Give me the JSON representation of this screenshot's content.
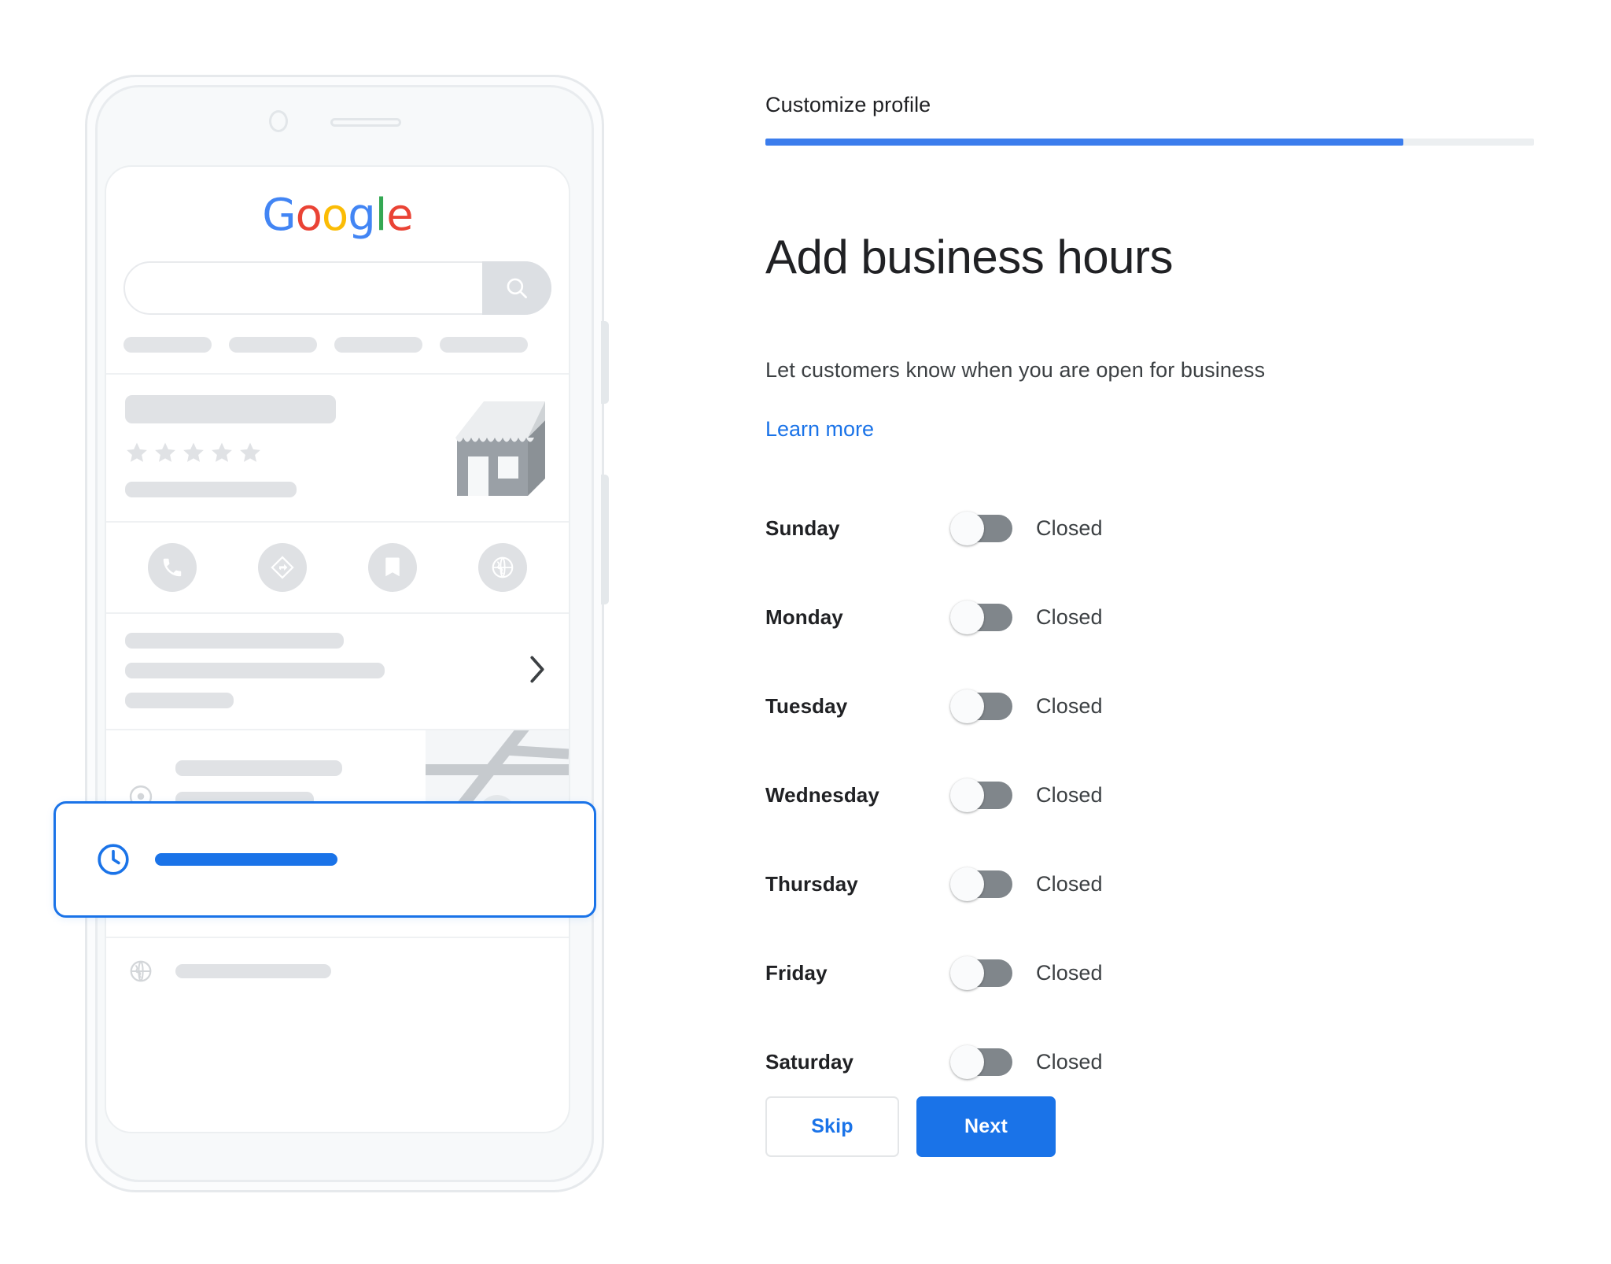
{
  "meta": {
    "accent_blue": "#1a73e8",
    "progress_blue": "#3b7ded",
    "toggle_track_gray": "#80868b",
    "skeleton_gray": "#e0e2e5",
    "text_primary": "#202124",
    "text_secondary": "#3c4043"
  },
  "header": {
    "step_label": "Customize profile",
    "progress_percent": 83
  },
  "main": {
    "title": "Add business hours",
    "subtitle": "Let customers know when you are open for business",
    "learn_more_label": "Learn more"
  },
  "hours": {
    "closed_label": "Closed",
    "days": [
      {
        "name": "Sunday",
        "state": "Closed",
        "enabled": false
      },
      {
        "name": "Monday",
        "state": "Closed",
        "enabled": false
      },
      {
        "name": "Tuesday",
        "state": "Closed",
        "enabled": false
      },
      {
        "name": "Wednesday",
        "state": "Closed",
        "enabled": false
      },
      {
        "name": "Thursday",
        "state": "Closed",
        "enabled": false
      },
      {
        "name": "Friday",
        "state": "Closed",
        "enabled": false
      },
      {
        "name": "Saturday",
        "state": "Closed",
        "enabled": false
      }
    ]
  },
  "actions": {
    "skip_label": "Skip",
    "next_label": "Next"
  },
  "phone_preview": {
    "brand": {
      "full": "Google",
      "letters": [
        {
          "char": "G",
          "color": "#4285F4"
        },
        {
          "char": "o",
          "color": "#EA4335"
        },
        {
          "char": "o",
          "color": "#FBBC05"
        },
        {
          "char": "g",
          "color": "#4285F4"
        },
        {
          "char": "l",
          "color": "#34A853"
        },
        {
          "char": "e",
          "color": "#EA4335"
        }
      ]
    },
    "search": {
      "value": "",
      "placeholder": ""
    },
    "rating_stars": 5,
    "action_icons": [
      "call-icon",
      "directions-icon",
      "save-icon",
      "website-icon"
    ],
    "highlight_card": {
      "icon": "clock-icon",
      "highlighted": true
    }
  }
}
